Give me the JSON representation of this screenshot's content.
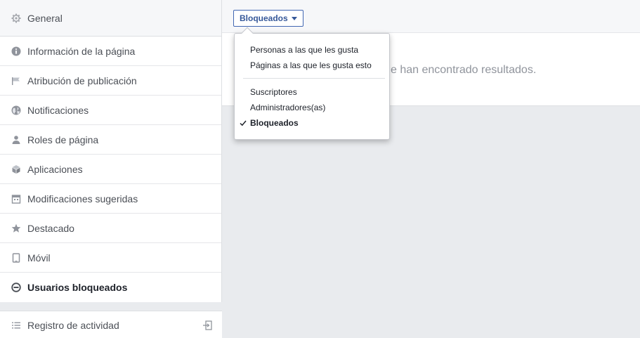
{
  "sidebar": {
    "items": [
      {
        "label": "General",
        "icon": "gear-icon"
      },
      {
        "label": "Información de la página",
        "icon": "info-icon"
      },
      {
        "label": "Atribución de publicación",
        "icon": "flag-icon"
      },
      {
        "label": "Notificaciones",
        "icon": "globe-icon"
      },
      {
        "label": "Roles de página",
        "icon": "person-icon"
      },
      {
        "label": "Aplicaciones",
        "icon": "cube-icon"
      },
      {
        "label": "Modificaciones sugeridas",
        "icon": "calendar-icon"
      },
      {
        "label": "Destacado",
        "icon": "star-icon"
      },
      {
        "label": "Móvil",
        "icon": "mobile-icon"
      },
      {
        "label": "Usuarios bloqueados",
        "icon": "blocked-icon"
      }
    ],
    "activity": {
      "label": "Registro de actividad",
      "icon": "list-icon",
      "action_icon": "exit-icon"
    }
  },
  "main": {
    "filter_label": "Bloqueados",
    "empty_text": "e han encontrado resultados."
  },
  "dropdown": {
    "group1": [
      {
        "label": "Personas a las que les gusta"
      },
      {
        "label": "Páginas a las que les gusta esto"
      }
    ],
    "group2": [
      {
        "label": "Suscriptores"
      },
      {
        "label": "Administradores(as)"
      },
      {
        "label": "Bloqueados",
        "selected": true
      }
    ]
  },
  "colors": {
    "background": "#e9ebee",
    "link_blue": "#365899",
    "border_blue": "#4267b2",
    "muted_text": "#90949c",
    "icon_gray": "#90949c"
  }
}
